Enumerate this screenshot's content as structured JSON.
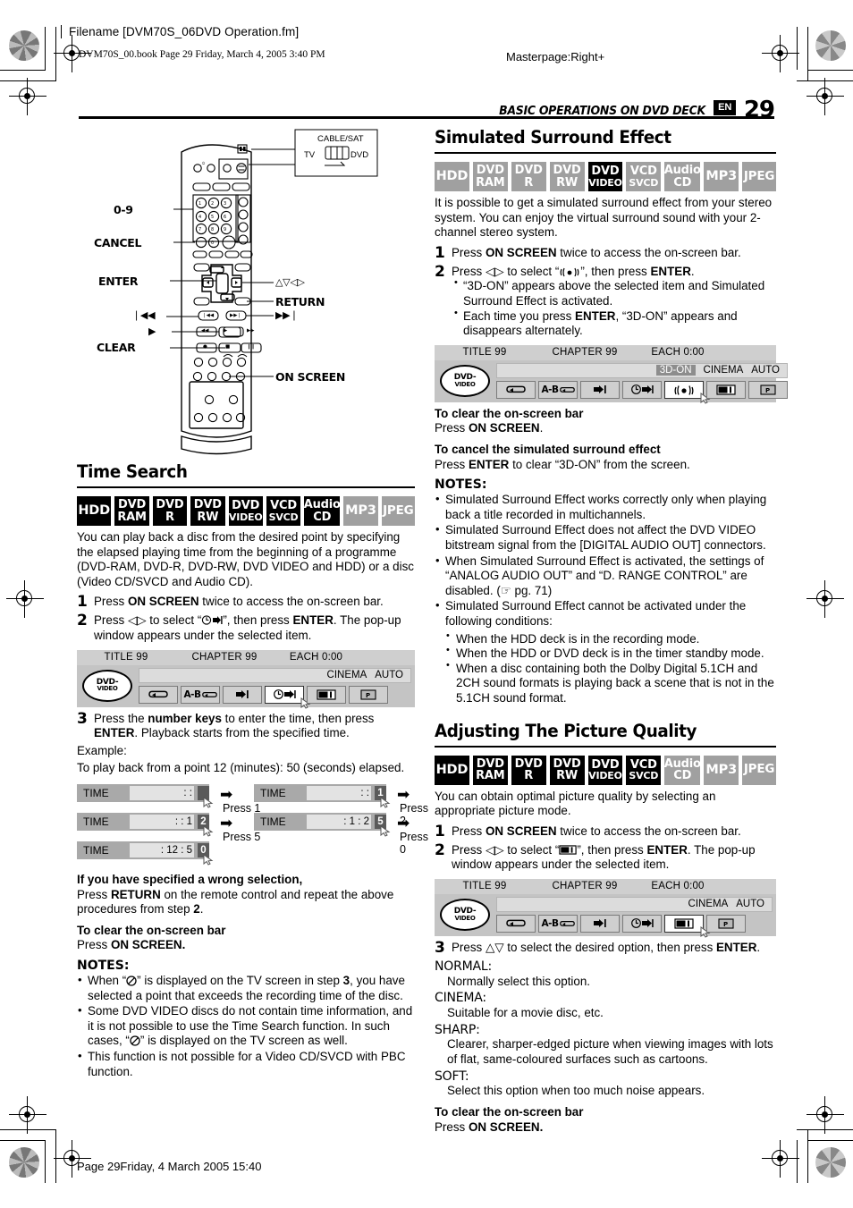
{
  "header": {
    "filename": "Filename [DVM70S_06DVD Operation.fm]",
    "bookline": "DVM70S_00.book  Page 29  Friday, March 4, 2005  3:40 PM",
    "masterpage": "Masterpage:Right+",
    "running_head": "BASIC OPERATIONS ON DVD DECK",
    "lang_code": "EN",
    "page_number": "29"
  },
  "footer": {
    "text": "Page 29Friday, 4 March 2005  15:40"
  },
  "remote": {
    "callouts": {
      "num_keys": "0-9",
      "cancel": "CANCEL",
      "enter": "ENTER",
      "arrows": "△▽◁▷",
      "return": "RETURN",
      "skip_back": "❘◀◀",
      "skip_fwd": "▶▶❘",
      "play": "▶",
      "clear": "CLEAR",
      "on_screen": "ON SCREEN"
    },
    "switch": {
      "title": "CABLE/SAT",
      "left": "TV",
      "right": "DVD"
    }
  },
  "time_search": {
    "title": "Time Search",
    "badges": [
      {
        "l1": "HDD",
        "l2": "",
        "state": "on"
      },
      {
        "l1": "DVD",
        "l2": "RAM",
        "state": "on"
      },
      {
        "l1": "DVD",
        "l2": "R",
        "state": "on"
      },
      {
        "l1": "DVD",
        "l2": "RW",
        "state": "on"
      },
      {
        "l1": "DVD",
        "l2": "VIDEO",
        "state": "on"
      },
      {
        "l1": "VCD",
        "l2": "SVCD",
        "state": "on"
      },
      {
        "l1": "Audio",
        "l2": "CD",
        "state": "on"
      },
      {
        "l1": "MP3",
        "l2": "",
        "state": "off"
      },
      {
        "l1": "JPEG",
        "l2": "",
        "state": "off"
      }
    ],
    "intro": "You can play back a disc from the desired point by specifying the elapsed playing time from the beginning of a programme (DVD-RAM, DVD-R, DVD-RW, DVD VIDEO and HDD) or a disc (Video CD/SVCD and Audio CD).",
    "step1_num": "1",
    "step1_a": "Press ",
    "step1_b": "ON SCREEN",
    "step1_c": " twice to access the on-screen bar.",
    "step2_num": "2",
    "step2_a": "Press ◁▷ to select “",
    "step2_icon": "time-search-icon",
    "step2_b": "”, then press ",
    "step2_c": "ENTER",
    "step2_d": ". The pop-up window appears under the selected item.",
    "osb": {
      "title": "TITLE 99",
      "chapter": "CHAPTER 99",
      "each": "EACH 0:00",
      "disc_l1": "DVD-",
      "disc_l2": "VIDEO",
      "cinema": "CINEMA",
      "auto": "AUTO",
      "three_d": "",
      "selected": "time"
    },
    "step3_num": "3",
    "step3_a": "Press the ",
    "step3_b": "number keys",
    "step3_c": " to enter the time, then press ",
    "step3_d": "ENTER",
    "step3_e": ". Playback starts from the specified time.",
    "example_label": "Example:",
    "example_text": "To play back from a point 12 (minutes): 50 (seconds) elapsed.",
    "time_boxes": [
      {
        "label": "TIME",
        "value": ":      :",
        "cursor": "",
        "press": "Press 1"
      },
      {
        "label": "TIME",
        "value": ":      :",
        "cursor": "1",
        "press": "Press 2"
      },
      {
        "label": "TIME",
        "value": ":     : 1",
        "cursor": "2",
        "press": "Press 5"
      },
      {
        "label": "TIME",
        "value": ":    1 : 2",
        "cursor": "5",
        "press": "Press 0"
      },
      {
        "label": "TIME",
        "value": ":   12 : 5",
        "cursor": "0",
        "press": ""
      }
    ],
    "wrong_head": "If you have specified a wrong selection,",
    "wrong_a": "Press ",
    "wrong_b": "RETURN",
    "wrong_c": " on the remote control and repeat the above procedures from step ",
    "wrong_d": "2",
    "wrong_e": ".",
    "clear_head": "To clear the on-screen bar",
    "clear_a": "Press ",
    "clear_b": "ON SCREEN.",
    "notes_head": "NOTES:",
    "notes": [
      {
        "a": "When “",
        "icon": "no-entry-icon",
        "b": "” is displayed on the TV screen in step ",
        "bold": "3",
        "c": ", you have selected a point that exceeds the recording time of the disc."
      },
      {
        "a": "Some DVD VIDEO discs do not contain time information, and it is not possible to use the Time Search function. In such cases, “",
        "icon": "no-entry-icon",
        "b": "” is displayed on the TV screen as well.",
        "bold": "",
        "c": ""
      },
      {
        "a": "This function is not possible for a Video CD/SVCD with PBC function.",
        "icon": "",
        "b": "",
        "bold": "",
        "c": ""
      }
    ]
  },
  "surround": {
    "title": "Simulated Surround Effect",
    "badges": [
      {
        "l1": "HDD",
        "l2": "",
        "state": "off"
      },
      {
        "l1": "DVD",
        "l2": "RAM",
        "state": "off"
      },
      {
        "l1": "DVD",
        "l2": "R",
        "state": "off"
      },
      {
        "l1": "DVD",
        "l2": "RW",
        "state": "off"
      },
      {
        "l1": "DVD",
        "l2": "VIDEO",
        "state": "on"
      },
      {
        "l1": "VCD",
        "l2": "SVCD",
        "state": "off"
      },
      {
        "l1": "Audio",
        "l2": "CD",
        "state": "off"
      },
      {
        "l1": "MP3",
        "l2": "",
        "state": "off"
      },
      {
        "l1": "JPEG",
        "l2": "",
        "state": "off"
      }
    ],
    "intro": "It is possible to get a simulated surround effect from your stereo system. You can enjoy the virtual surround sound with your 2-channel stereo system.",
    "step1_num": "1",
    "step1_a": "Press ",
    "step1_b": "ON SCREEN",
    "step1_c": " twice to access the on-screen bar.",
    "step2_num": "2",
    "step2_a": "Press ◁▷ to select “",
    "step2_icon": "surround-icon",
    "step2_b": "”, then press ",
    "step2_c": "ENTER",
    "step2_d": ".",
    "step2_bullets": [
      "“3D-ON” appears above the selected item and Simulated Surround Effect is activated.",
      "Each time you press ENTER, “3D-ON” appears and disappears alternately."
    ],
    "osb": {
      "title": "TITLE 99",
      "chapter": "CHAPTER 99",
      "each": "EACH 0:00",
      "disc_l1": "DVD-",
      "disc_l2": "VIDEO",
      "cinema": "CINEMA",
      "auto": "AUTO",
      "three_d": "3D-ON",
      "selected": "surround"
    },
    "clear_head": "To clear the on-screen bar",
    "clear_a": "Press ",
    "clear_b": "ON SCREEN",
    "clear_c": ".",
    "cancel_head": "To cancel the simulated surround effect",
    "cancel_a": "Press ",
    "cancel_b": "ENTER",
    "cancel_c": " to clear “3D-ON” from the screen.",
    "notes_head": "NOTES:",
    "notes": [
      "Simulated Surround Effect works correctly only when playing back a title recorded in multichannels.",
      "Simulated Surround Effect does not affect the DVD VIDEO bitstream signal from the [DIGITAL AUDIO OUT] connectors.",
      "When Simulated Surround Effect is activated, the settings of “ANALOG AUDIO OUT” and “D. RANGE CONTROL” are disabled. (☞ pg. 71)",
      "Simulated Surround Effect cannot be activated under the following conditions:"
    ],
    "subnotes": [
      "When the HDD deck is in the recording mode.",
      "When the HDD or DVD deck is in the timer standby mode.",
      "When a disc containing both the Dolby Digital 5.1CH and 2CH sound formats is playing back a scene that is not in the 5.1CH sound format."
    ]
  },
  "picture": {
    "title": "Adjusting The Picture Quality",
    "badges": [
      {
        "l1": "HDD",
        "l2": "",
        "state": "on"
      },
      {
        "l1": "DVD",
        "l2": "RAM",
        "state": "on"
      },
      {
        "l1": "DVD",
        "l2": "R",
        "state": "on"
      },
      {
        "l1": "DVD",
        "l2": "RW",
        "state": "on"
      },
      {
        "l1": "DVD",
        "l2": "VIDEO",
        "state": "on"
      },
      {
        "l1": "VCD",
        "l2": "SVCD",
        "state": "on"
      },
      {
        "l1": "Audio",
        "l2": "CD",
        "state": "off"
      },
      {
        "l1": "MP3",
        "l2": "",
        "state": "off"
      },
      {
        "l1": "JPEG",
        "l2": "",
        "state": "off"
      }
    ],
    "intro": "You can obtain optimal picture quality by selecting an appropriate picture mode.",
    "step1_num": "1",
    "step1_a": "Press ",
    "step1_b": "ON SCREEN",
    "step1_c": " twice to access the on-screen bar.",
    "step2_num": "2",
    "step2_a": "Press ◁▷ to select “",
    "step2_icon": "picture-quality-icon",
    "step2_b": "”, then press ",
    "step2_c": "ENTER",
    "step2_d": ". The pop-up window appears under the selected item.",
    "osb": {
      "title": "TITLE 99",
      "chapter": "CHAPTER 99",
      "each": "EACH 0:00",
      "disc_l1": "DVD-",
      "disc_l2": "VIDEO",
      "cinema": "CINEMA",
      "auto": "AUTO",
      "three_d": "",
      "selected": "picture"
    },
    "step3_num": "3",
    "step3_a": "Press △▽ to select the desired option, then press ",
    "step3_b": "ENTER",
    "step3_c": ".",
    "options": [
      {
        "name": "NORMAL:",
        "desc": "Normally select this option."
      },
      {
        "name": "CINEMA:",
        "desc": "Suitable for a movie disc, etc."
      },
      {
        "name": "SHARP:",
        "desc": "Clearer, sharper-edged picture when viewing images with lots of flat, same-coloured surfaces such as cartoons."
      },
      {
        "name": "SOFT:",
        "desc": "Select this option when too much noise appears."
      }
    ],
    "clear_head": "To clear the on-screen bar",
    "clear_a": "Press ",
    "clear_b": "ON SCREEN."
  }
}
